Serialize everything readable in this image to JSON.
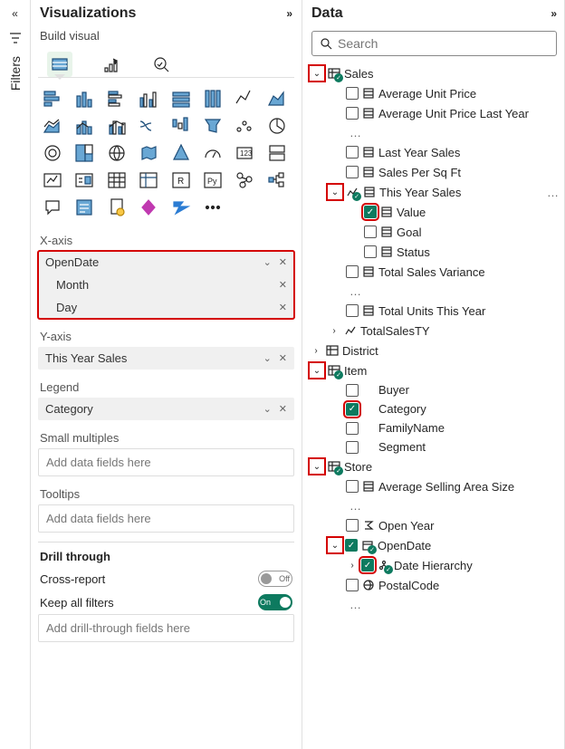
{
  "filters_label": "Filters",
  "viz": {
    "title": "Visualizations",
    "subtitle": "Build visual",
    "xaxis_label": "X-axis",
    "xaxis_fields": {
      "root": "OpenDate",
      "child1": "Month",
      "child2": "Day"
    },
    "yaxis_label": "Y-axis",
    "yaxis_field": "This Year Sales",
    "legend_label": "Legend",
    "legend_field": "Category",
    "small_mult_label": "Small multiples",
    "tooltips_label": "Tooltips",
    "placeholder": "Add data fields here",
    "drill_label": "Drill through",
    "cross_report": "Cross-report",
    "keep_filters": "Keep all filters",
    "off": "Off",
    "on": "On",
    "drill_placeholder": "Add drill-through fields here"
  },
  "data": {
    "title": "Data",
    "search_placeholder": "Search",
    "sales": "Sales",
    "avg_unit_price": "Average Unit Price",
    "avg_unit_price_ly": "Average Unit Price Last Year",
    "last_year_sales": "Last Year Sales",
    "sales_per_sqft": "Sales Per Sq Ft",
    "this_year_sales": "This Year Sales",
    "value": "Value",
    "goal": "Goal",
    "status": "Status",
    "total_sales_var": "Total Sales Variance",
    "total_units_ty": "Total Units This Year",
    "total_sales_ty": "TotalSalesTY",
    "district": "District",
    "item": "Item",
    "buyer": "Buyer",
    "category": "Category",
    "family_name": "FamilyName",
    "segment": "Segment",
    "store": "Store",
    "avg_sell_area": "Average Selling Area Size",
    "open_year": "Open Year",
    "open_date": "OpenDate",
    "date_hierarchy": "Date Hierarchy",
    "postal_code": "PostalCode",
    "ellipsis": "…"
  }
}
